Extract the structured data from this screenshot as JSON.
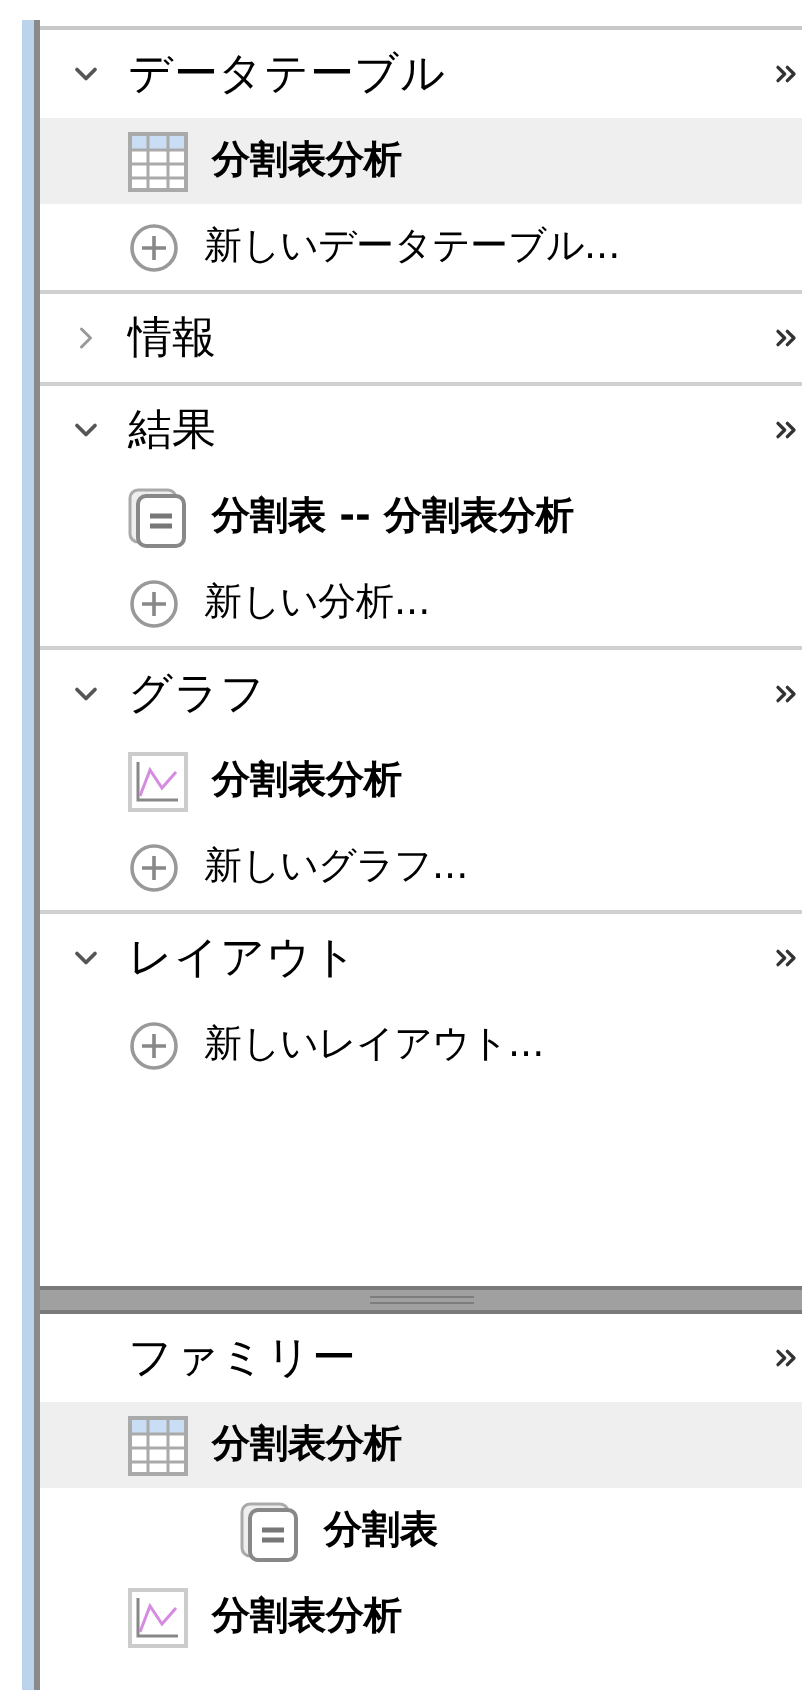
{
  "sections": [
    {
      "title": "データテーブル",
      "expanded": true,
      "items": [
        {
          "kind": "table",
          "label": "分割表分析",
          "selected": true
        },
        {
          "kind": "new",
          "label": "新しいデータテーブル...",
          "selected": false
        }
      ]
    },
    {
      "title": "情報",
      "expanded": false
    },
    {
      "title": "結果",
      "expanded": true,
      "items": [
        {
          "kind": "report",
          "label": "分割表 -- 分割表分析",
          "selected": false
        },
        {
          "kind": "new",
          "label": "新しい分析...",
          "selected": false
        }
      ]
    },
    {
      "title": "グラフ",
      "expanded": true,
      "items": [
        {
          "kind": "graph",
          "label": "分割表分析",
          "selected": false
        },
        {
          "kind": "new",
          "label": "新しいグラフ...",
          "selected": false
        }
      ]
    },
    {
      "title": "レイアウト",
      "expanded": true,
      "items": [
        {
          "kind": "new",
          "label": "新しいレイアウト...",
          "selected": false
        }
      ]
    }
  ],
  "family": {
    "title": "ファミリー",
    "items": [
      {
        "kind": "table",
        "label": "分割表分析",
        "selected": true,
        "children": [
          {
            "kind": "report",
            "label": "分割表",
            "selected": false
          }
        ]
      },
      {
        "kind": "graph",
        "label": "分割表分析",
        "selected": false
      }
    ]
  }
}
